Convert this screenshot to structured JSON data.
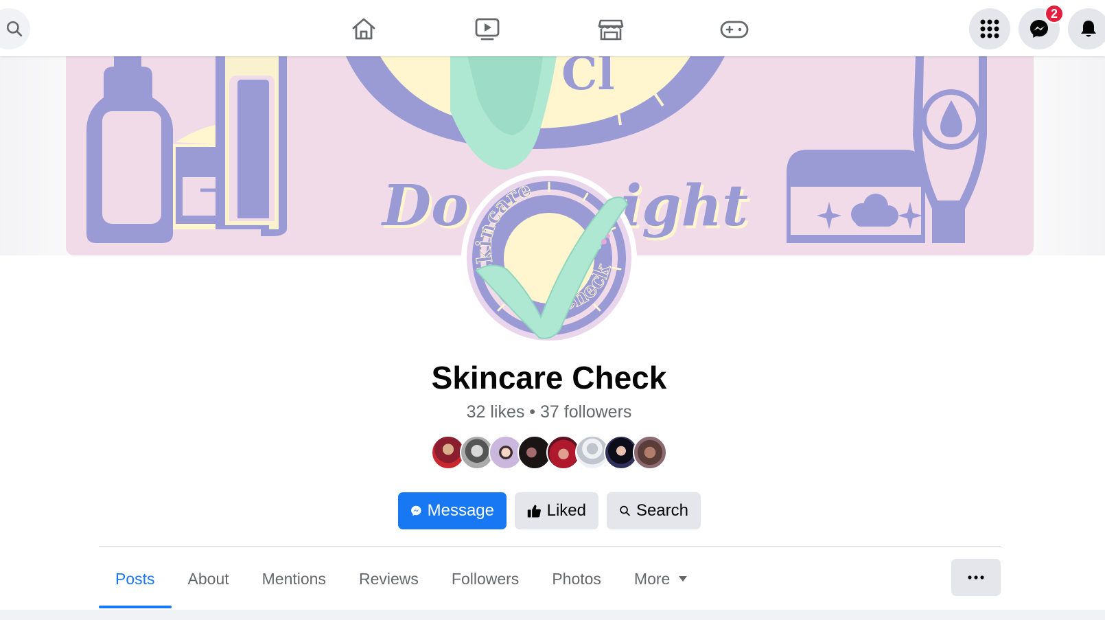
{
  "topbar": {
    "icons": [
      "search-icon",
      "home-icon",
      "video-icon",
      "marketplace-icon",
      "gaming-icon",
      "menu-grid-icon",
      "messenger-icon",
      "notifications-icon"
    ],
    "messenger_badge": "2"
  },
  "cover": {
    "text_left": "Do",
    "text_right": "ight",
    "brand_colors": {
      "background": "#f1dbe9",
      "lavender": "#9a9ad4",
      "mint": "#aee8d3",
      "cream": "#fff5cf"
    }
  },
  "profile": {
    "logo_text_top": "Skincare",
    "logo_text_bottom": "Check",
    "name": "Skincare Check",
    "likes": "32 likes",
    "separator": "•",
    "followers": "37 followers"
  },
  "actions": {
    "message": "Message",
    "liked": "Liked",
    "search": "Search"
  },
  "tabs": {
    "posts": "Posts",
    "about": "About",
    "mentions": "Mentions",
    "reviews": "Reviews",
    "followers": "Followers",
    "photos": "Photos",
    "more": "More"
  },
  "colors": {
    "accent": "#1877f2",
    "badge": "#e41e3f",
    "secondary_text": "#65676b"
  }
}
